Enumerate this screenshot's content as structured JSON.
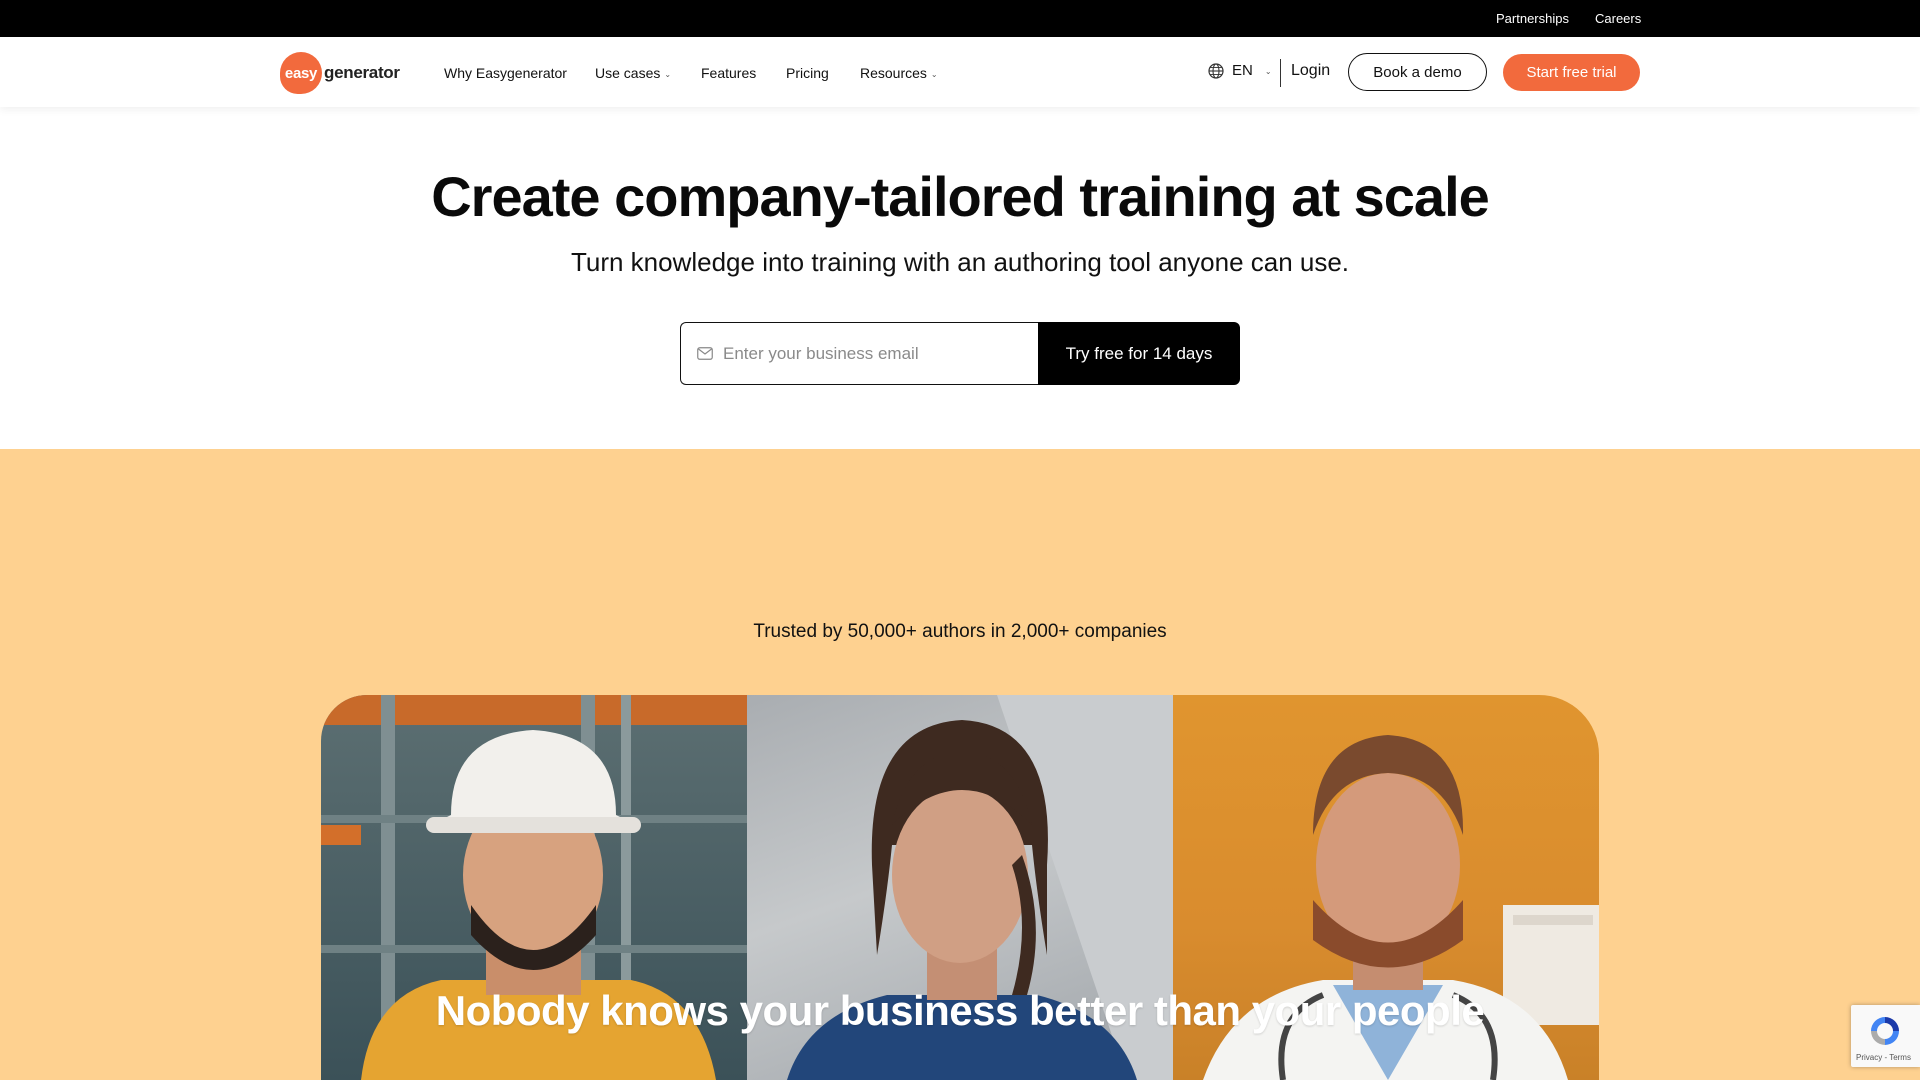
{
  "topbar": {
    "links": [
      "Partnerships",
      "Careers"
    ]
  },
  "nav": {
    "logo_prefix": "easy",
    "logo_suffix": "generator",
    "items": [
      {
        "label": "Why Easygenerator",
        "dropdown": false
      },
      {
        "label": "Use cases",
        "dropdown": true
      },
      {
        "label": "Features",
        "dropdown": false
      },
      {
        "label": "Pricing",
        "dropdown": false
      },
      {
        "label": "Resources",
        "dropdown": true
      }
    ],
    "language": "EN",
    "login": "Login",
    "book_demo": "Book a demo",
    "start_trial": "Start free trial"
  },
  "hero": {
    "title": "Create company-tailored training at scale",
    "subtitle": "Turn knowledge into training with an authoring tool anyone can use.",
    "email_placeholder": "Enter your business email",
    "cta": "Try free for 14 days"
  },
  "trust": {
    "text": "Trusted by 50,000+ authors in 2,000+ companies"
  },
  "panel": {
    "headline": "Nobody knows your business better than your people",
    "photos": [
      "construction-worker-photo",
      "woman-portrait-photo",
      "doctor-portrait-photo"
    ]
  },
  "recaptcha": {
    "terms": "Privacy - Terms"
  },
  "colors": {
    "brand_orange": "#f26a3d",
    "peach_bg": "#fed190",
    "topbar_bg": "#000000"
  }
}
